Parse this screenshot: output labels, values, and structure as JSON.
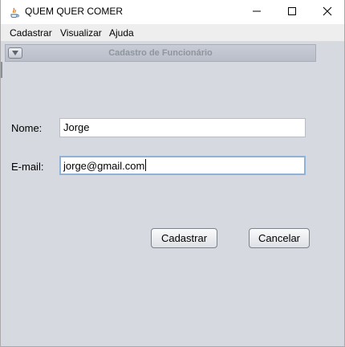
{
  "window": {
    "title": "QUEM QUER COMER",
    "controls": {
      "minimize_icon": "minimize-icon",
      "maximize_icon": "maximize-icon",
      "close_icon": "close-icon"
    }
  },
  "menubar": {
    "items": [
      {
        "label": "Cadastrar"
      },
      {
        "label": "Visualizar"
      },
      {
        "label": "Ajuda"
      }
    ]
  },
  "internal_frame": {
    "title": "Cadastro de Funcionário",
    "menu_icon": "chevron-down-icon"
  },
  "form": {
    "nome_label": "Nome:",
    "nome_value": "Jorge",
    "email_label": "E-mail:",
    "email_value": "jorge@gmail.com"
  },
  "actions": {
    "submit_label": "Cadastrar",
    "cancel_label": "Cancelar"
  },
  "colors": {
    "desktop_bg": "#d6d9df",
    "focus_border": "#8fb2d6"
  }
}
